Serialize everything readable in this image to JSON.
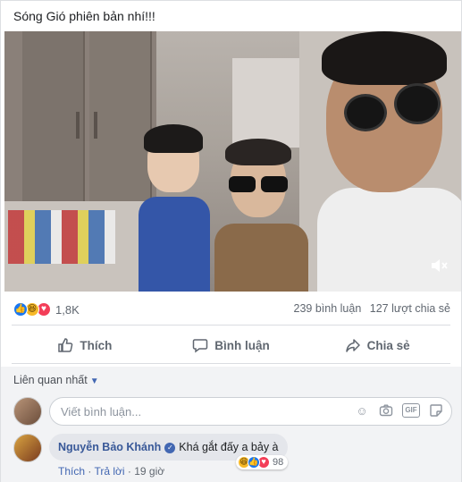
{
  "post": {
    "caption": "Sóng Gió phiên bản nhí!!!"
  },
  "video": {
    "mute_icon": "speaker-muted-icon"
  },
  "reactions": {
    "types": [
      "like",
      "haha",
      "love"
    ],
    "count": "1,8K",
    "comments_count": "239 bình luận",
    "shares_count": "127 lượt chia sẻ"
  },
  "actions": {
    "like_label": "Thích",
    "comment_label": "Bình luận",
    "share_label": "Chia sẻ"
  },
  "comments": {
    "sort_label": "Liên quan nhất",
    "input_placeholder": "Viết bình luận...",
    "items": [
      {
        "author": "Nguyễn Bảo Khánh",
        "verified": true,
        "text": "Khá gắt đấy a bảy à",
        "reaction_types": [
          "haha",
          "like",
          "love"
        ],
        "reaction_count": "98",
        "like_label": "Thích",
        "reply_label": "Trả lời",
        "time": "19 giờ"
      }
    ]
  },
  "colors": {
    "link": "#385898",
    "accent": "#4267b2",
    "muted_text": "#606770",
    "like": "#1877f2",
    "haha": "#f7b928",
    "love": "#f33e58"
  }
}
